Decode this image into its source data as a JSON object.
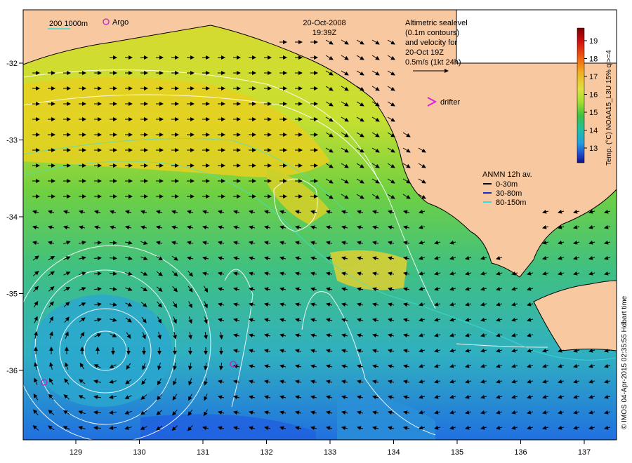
{
  "header": {
    "date": "20-Oct-2008",
    "time": "19:39Z"
  },
  "scale_legend": {
    "contours": "200  1000m",
    "argo_label": "Argo"
  },
  "altimetry_note": [
    "Altimetric sealevel",
    "(0.1m contours)",
    "and velocity for",
    "20-Oct 19Z",
    "0.5m/s (1kt 24h)"
  ],
  "drifter_label": "drifter",
  "anmn": {
    "title": "ANMN 12h av.",
    "items": [
      {
        "label": "0-30m",
        "color": "#000000"
      },
      {
        "label": "30-80m",
        "color": "#1030c0"
      },
      {
        "label": "80-150m",
        "color": "#30e0e0"
      }
    ]
  },
  "colorbar": {
    "label": "Temp. (°C) NOAA15_L3U 15% ql>=4",
    "ticks": [
      "19",
      "18",
      "17",
      "16",
      "15",
      "14",
      "13"
    ],
    "stops": [
      "#7a0000",
      "#d01010",
      "#f06010",
      "#f0b020",
      "#e0e040",
      "#a0e030",
      "#40c040",
      "#20c0a0",
      "#20a0e0",
      "#2050d0",
      "#101090"
    ]
  },
  "x_ticks": [
    "129",
    "130",
    "131",
    "132",
    "133",
    "134",
    "135",
    "136",
    "137"
  ],
  "y_ticks": [
    "-32",
    "-33",
    "-34",
    "-35",
    "-36"
  ],
  "credit": "© IMOS 04-Apr-2015 02:35:55 Hdbart time",
  "colors": {
    "land": "#f8c8a0",
    "sst_warm": "#e8d830",
    "sst_mid": "#70d040",
    "sst_cool": "#30c0a0",
    "sst_cold": "#2090e0"
  }
}
